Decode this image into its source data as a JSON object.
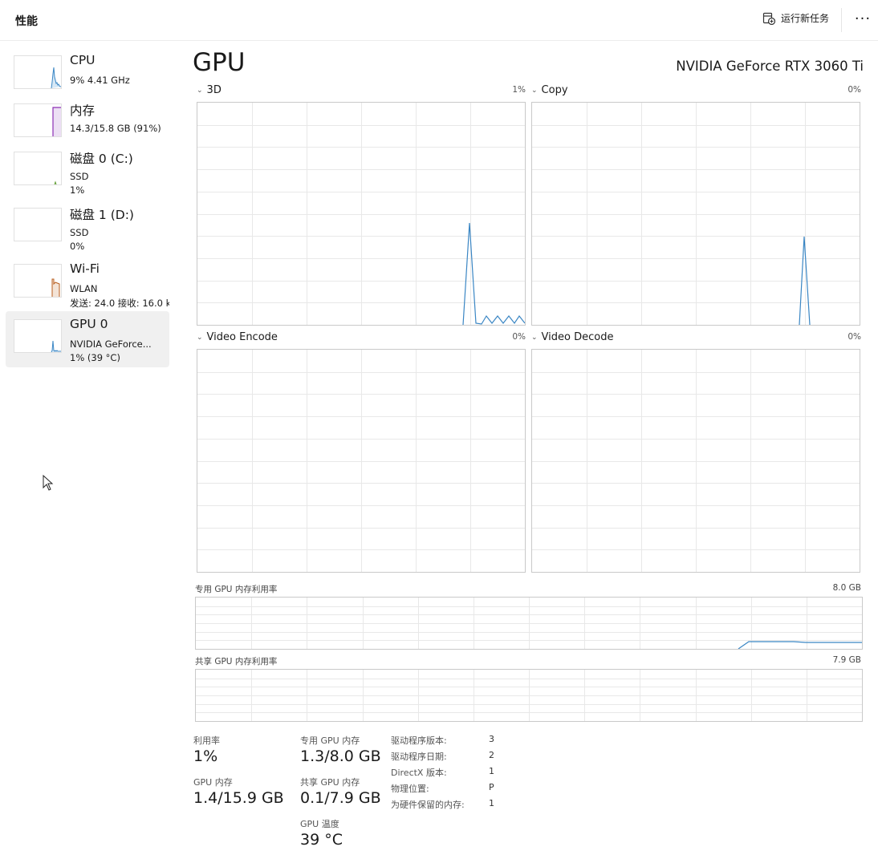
{
  "header": {
    "title": "性能",
    "run_task_label": "运行新任务",
    "more_label": "···",
    "run_task_icon": "run-new-task-icon",
    "more_icon": "more-options-icon"
  },
  "sidebar": {
    "items": [
      {
        "name": "CPU",
        "sub1": "9% 4.41 GHz",
        "sub2": "",
        "color": "#3a86c4"
      },
      {
        "name": "内存",
        "sub1": "14.3/15.8 GB (91%)",
        "sub2": "",
        "color": "#8d2fb5"
      },
      {
        "name": "磁盘 0 (C:)",
        "sub1": "SSD",
        "sub2": "1%",
        "color": "#5a9a2a"
      },
      {
        "name": "磁盘 1 (D:)",
        "sub1": "SSD",
        "sub2": "0%",
        "color": "#5a9a2a"
      },
      {
        "name": "Wi-Fi",
        "sub1": "WLAN",
        "sub2": "发送: 24.0 接收: 16.0 k",
        "color": "#b85c1d"
      },
      {
        "name": "GPU 0",
        "sub1": "NVIDIA GeForce...",
        "sub2": "1% (39 °C)",
        "color": "#3a86c4",
        "selected": true
      }
    ]
  },
  "main": {
    "title": "GPU",
    "model": "NVIDIA GeForce RTX 3060 Ti",
    "graphs": [
      {
        "label": "3D",
        "value": "1%"
      },
      {
        "label": "Copy",
        "value": "0%"
      },
      {
        "label": "Video Encode",
        "value": "0%"
      },
      {
        "label": "Video Decode",
        "value": "0%"
      }
    ],
    "dedicated_mem": {
      "label": "专用 GPU 内存利用率",
      "max": "8.0 GB"
    },
    "shared_mem": {
      "label": "共享 GPU 内存利用率",
      "max": "7.9 GB"
    },
    "stats": {
      "utilization_label": "利用率",
      "utilization_value": "1%",
      "gpu_mem_label": "GPU 内存",
      "gpu_mem_value": "1.4/15.9 GB",
      "dedicated_label": "专用 GPU 内存",
      "dedicated_value": "1.3/8.0 GB",
      "shared_label": "共享 GPU 内存",
      "shared_value": "0.1/7.9 GB",
      "temp_label": "GPU 温度",
      "temp_value": "39 °C"
    },
    "details": [
      {
        "key": "驱动程序版本:",
        "value": "3"
      },
      {
        "key": "驱动程序日期:",
        "value": "2"
      },
      {
        "key": "DirectX 版本:",
        "value": "1"
      },
      {
        "key": "物理位置:",
        "value": "P"
      },
      {
        "key": "为硬件保留的内存:",
        "value": "1"
      }
    ]
  },
  "colors": {
    "gpu_line": "#3a86c4",
    "grid": "#e8e8e8",
    "border": "#c9c9c9"
  }
}
